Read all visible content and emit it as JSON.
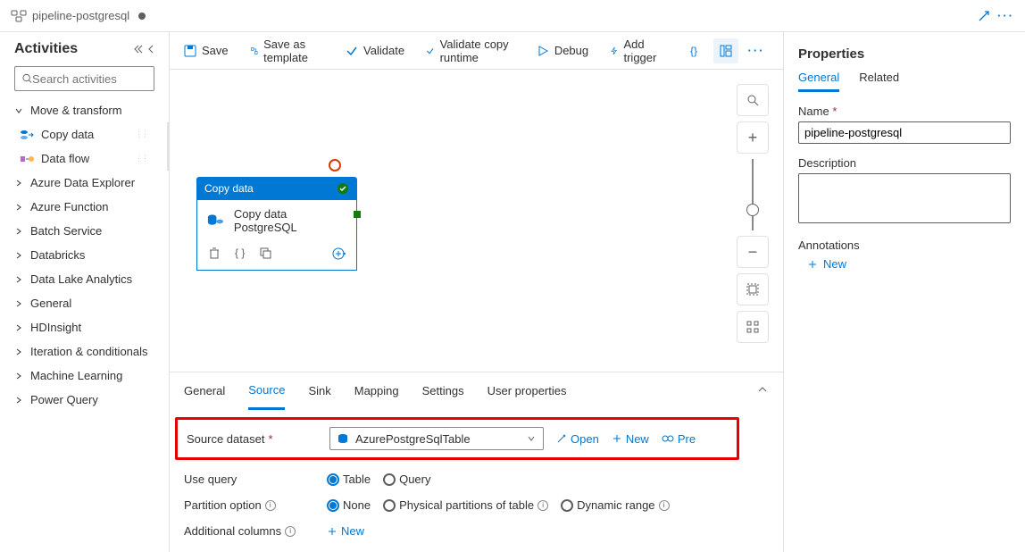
{
  "tab": {
    "title": "pipeline-postgresql"
  },
  "sidebar": {
    "title": "Activities",
    "searchPlaceholder": "Search activities",
    "groups": [
      {
        "label": "Move & transform",
        "expanded": true
      },
      {
        "label": "Azure Data Explorer"
      },
      {
        "label": "Azure Function"
      },
      {
        "label": "Batch Service"
      },
      {
        "label": "Databricks"
      },
      {
        "label": "Data Lake Analytics"
      },
      {
        "label": "General"
      },
      {
        "label": "HDInsight"
      },
      {
        "label": "Iteration & conditionals"
      },
      {
        "label": "Machine Learning"
      },
      {
        "label": "Power Query"
      }
    ],
    "activities": [
      {
        "label": "Copy data"
      },
      {
        "label": "Data flow"
      }
    ]
  },
  "toolbar": {
    "save": "Save",
    "saveTemplate": "Save as template",
    "validate": "Validate",
    "validateCopy": "Validate copy runtime",
    "debug": "Debug",
    "addTrigger": "Add trigger"
  },
  "node": {
    "type": "Copy data",
    "title": "Copy data PostgreSQL"
  },
  "bottomTabs": [
    {
      "label": "General"
    },
    {
      "label": "Source",
      "active": true
    },
    {
      "label": "Sink"
    },
    {
      "label": "Mapping"
    },
    {
      "label": "Settings"
    },
    {
      "label": "User properties"
    }
  ],
  "source": {
    "label": "Source dataset",
    "value": "AzurePostgreSqlTable",
    "open": "Open",
    "new": "New",
    "preview": "Pre",
    "useQueryLabel": "Use query",
    "options": {
      "table": "Table",
      "query": "Query"
    },
    "partitionLabel": "Partition option",
    "partitionOptions": {
      "none": "None",
      "physical": "Physical partitions of table",
      "dynamic": "Dynamic range"
    },
    "additionalColumns": "Additional columns",
    "newBtn": "New"
  },
  "props": {
    "heading": "Properties",
    "tabs": {
      "general": "General",
      "related": "Related"
    },
    "nameLabel": "Name",
    "nameValue": "pipeline-postgresql",
    "descLabel": "Description",
    "annotationsLabel": "Annotations",
    "newAnnotation": "New"
  }
}
